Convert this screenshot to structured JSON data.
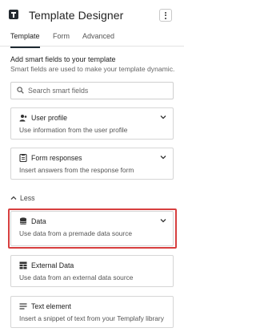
{
  "app": {
    "title": "Template Designer",
    "menu_icon": "kebab-menu-icon"
  },
  "tabs": [
    {
      "label": "Template",
      "active": true
    },
    {
      "label": "Form",
      "active": false
    },
    {
      "label": "Advanced",
      "active": false
    }
  ],
  "intro": {
    "title": "Add smart fields to your template",
    "subtitle": "Smart fields are used to make your template dynamic."
  },
  "search": {
    "placeholder": "Search smart fields",
    "icon": "search-icon"
  },
  "cards": [
    {
      "icon": "user-profile-icon",
      "title": "User profile",
      "description": "Use information from the user profile"
    },
    {
      "icon": "form-responses-icon",
      "title": "Form responses",
      "description": "Insert answers from the response form"
    },
    {
      "icon": "database-icon",
      "title": "Data",
      "description": "Use data from a premade data source",
      "highlighted": true
    },
    {
      "icon": "external-data-icon",
      "title": "External Data",
      "description": "Use data from an external data source"
    },
    {
      "icon": "text-element-icon",
      "title": "Text element",
      "description": "Insert a snippet of text from your Templafy library"
    }
  ],
  "less_toggle": {
    "label": "Less",
    "icon": "chevron-up-icon"
  },
  "colors": {
    "highlight": "#d73f3f",
    "text": "#2b2b2b",
    "border": "#d6d6d6",
    "tab_indicator": "#1f2a33"
  }
}
